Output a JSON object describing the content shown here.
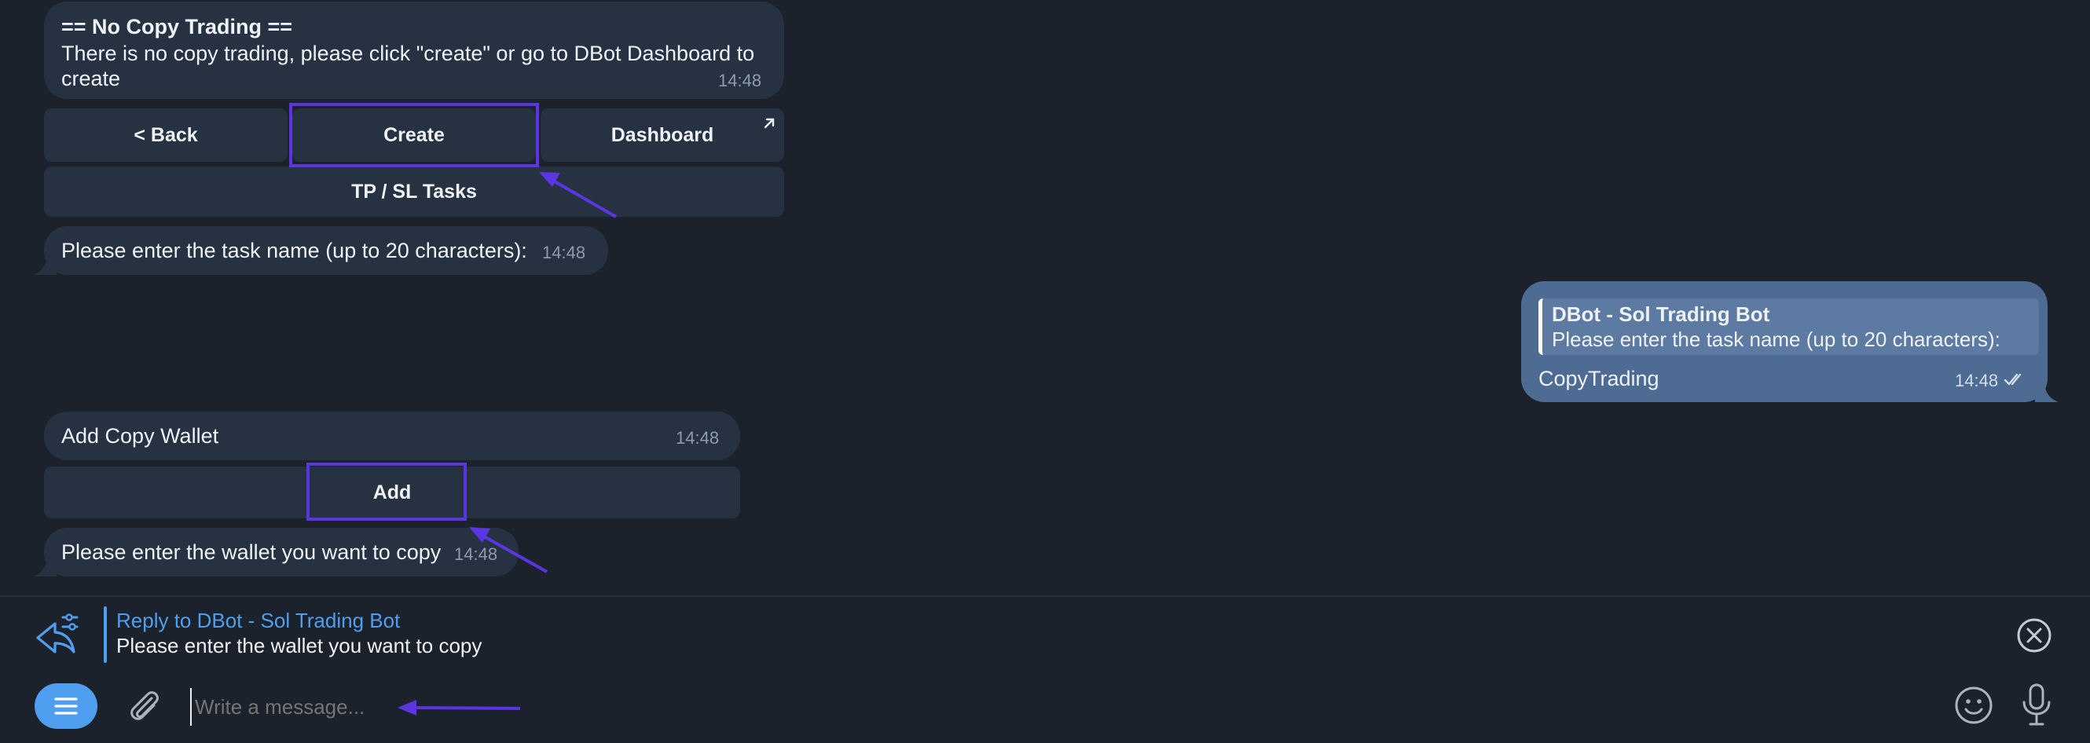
{
  "messages": {
    "no_copy": {
      "title": "== No Copy Trading ==",
      "line1": "There is no copy trading, please click \"create\" or go to DBot Dashboard to",
      "line2": "create",
      "time": "14:48"
    },
    "keyboard1": {
      "back": "< Back",
      "create": "Create",
      "dashboard": "Dashboard",
      "tpsl": "TP / SL Tasks"
    },
    "enter_task": {
      "text": "Please enter the task name (up to 20 characters):",
      "time": "14:48"
    },
    "reply": {
      "quote_author": "DBot - Sol Trading Bot",
      "quote_text": "Please enter the task name (up to 20 characters):",
      "text": "CopyTrading",
      "time": "14:48"
    },
    "add_copy": {
      "text": "Add Copy Wallet",
      "time": "14:48"
    },
    "keyboard2": {
      "add": "Add"
    },
    "enter_wallet": {
      "text": "Please enter the wallet you want to copy",
      "time": "14:48"
    }
  },
  "composer": {
    "reply_title": "Reply to DBot - Sol Trading Bot",
    "reply_text": "Please enter the wallet you want to copy",
    "placeholder": "Write a message..."
  },
  "colors": {
    "background": "#1b222c",
    "incoming_bubble": "#263242",
    "outgoing_bubble": "#4e6b94",
    "accent": "#4f9ef0",
    "annotation": "#5b35e0"
  }
}
